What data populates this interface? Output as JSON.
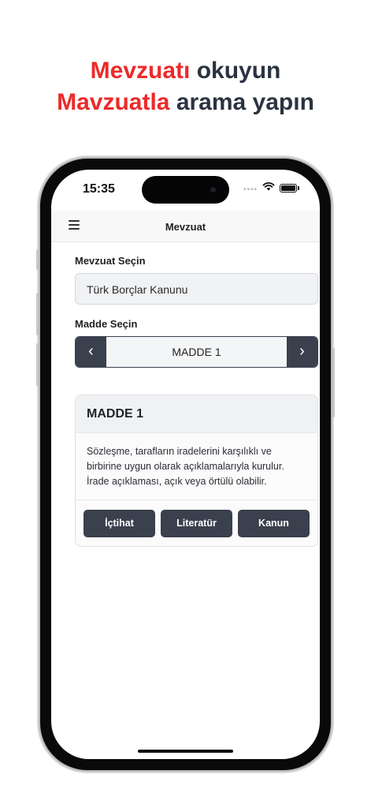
{
  "headline": {
    "line1_accent": "Mevzuatı",
    "line1_rest": "okuyun",
    "line2_accent": "Mavzuatla",
    "line2_rest": "arama yapın"
  },
  "colors": {
    "accent": "#ec2a2a",
    "headline_text": "#2a3340",
    "button_bg": "#3a404d"
  },
  "status_bar": {
    "time": "15:35",
    "signal": "••••"
  },
  "navbar": {
    "title": "Mevzuat",
    "menu_icon": "hamburger-menu-icon"
  },
  "form": {
    "law_label": "Mevzuat Seçin",
    "law_value": "Türk Borçlar Kanunu",
    "article_label": "Madde Seçin",
    "article_value": "MADDE 1",
    "prev_symbol": "‹",
    "next_symbol": "›"
  },
  "card": {
    "title": "MADDE 1",
    "body": "Sözleşme, tarafların iradelerini karşılıklı ve birbirine uygun olarak açıklamalarıyla kurulur. İrade açıklaması, açık veya örtülü olabilir.",
    "buttons": {
      "ictihat": "İçtihat",
      "literatur": "Literatür",
      "kanun": "Kanun"
    }
  }
}
